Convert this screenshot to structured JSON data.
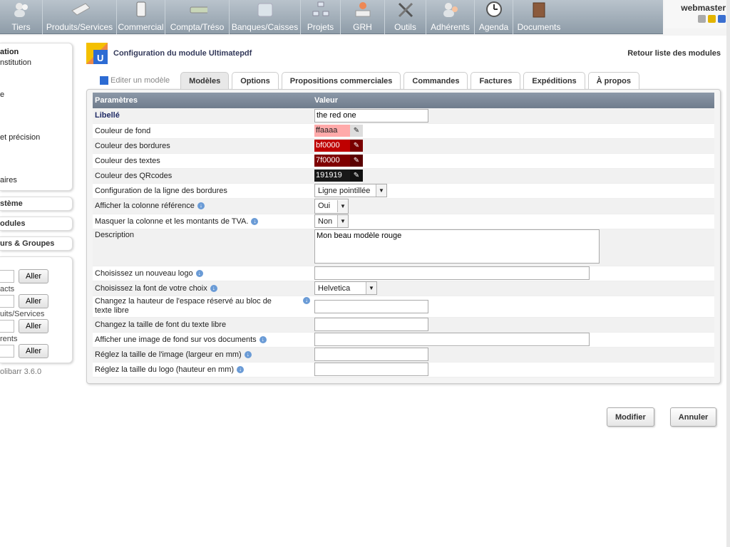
{
  "menu": [
    {
      "label": "Tiers",
      "icon": "users-icon"
    },
    {
      "label": "Produits/Services",
      "icon": "product-icon"
    },
    {
      "label": "Commercial",
      "icon": "briefcase-icon"
    },
    {
      "label": "Compta/Tréso",
      "icon": "money-icon"
    },
    {
      "label": "Banques/Caisses",
      "icon": "bank-icon"
    },
    {
      "label": "Projets",
      "icon": "project-icon"
    },
    {
      "label": "GRH",
      "icon": "hr-icon"
    },
    {
      "label": "Outils",
      "icon": "tools-icon"
    },
    {
      "label": "Adhérents",
      "icon": "members-icon"
    },
    {
      "label": "Agenda",
      "icon": "clock-icon"
    },
    {
      "label": "Documents",
      "icon": "documents-icon"
    }
  ],
  "login": {
    "user": "webmaster"
  },
  "sidebar": {
    "items": [
      "ation",
      "nstitution",
      "",
      "",
      "e",
      "",
      "",
      "",
      "et précision",
      "",
      "",
      "",
      "aires"
    ],
    "blocks": [
      "stème",
      "odules",
      "urs & Groupes"
    ],
    "search": [
      {
        "label": "",
        "button": "Aller"
      },
      {
        "label": "acts",
        "button": "Aller"
      },
      {
        "label": "uits/Services",
        "button": "Aller"
      },
      {
        "label": "rents",
        "button": "Aller"
      }
    ],
    "version": "olibarr 3.6.0"
  },
  "header": {
    "title": "Configuration du module Ultimatepdf",
    "back": "Retour liste des modules"
  },
  "tabs": [
    {
      "label": "Editer un modèle",
      "state": "plain"
    },
    {
      "label": "Modèles",
      "state": "active"
    },
    {
      "label": "Options",
      "state": ""
    },
    {
      "label": "Propositions commerciales",
      "state": ""
    },
    {
      "label": "Commandes",
      "state": ""
    },
    {
      "label": "Factures",
      "state": ""
    },
    {
      "label": "Expéditions",
      "state": ""
    },
    {
      "label": "À propos",
      "state": ""
    }
  ],
  "table": {
    "col_params": "Paramètres",
    "col_value": "Valeur",
    "libelle_label": "Libellé",
    "libelle_value": "the red one",
    "bg_label": "Couleur de fond",
    "bg_value": "ffaaaa",
    "bg_color": "#ffaaaa",
    "border_label": "Couleur des bordures",
    "border_value": "bf0000",
    "border_color": "#bf0000",
    "text_label": "Couleur des textes",
    "text_value": "7f0000",
    "text_color": "#7f0000",
    "qr_label": "Couleur des QRcodes",
    "qr_value": "191919",
    "qr_color": "#191919",
    "line_label": "Configuration de la ligne des bordures",
    "line_value": "Ligne pointillée",
    "ref_label": "Afficher la colonne référence",
    "ref_value": "Oui",
    "vat_label": "Masquer la colonne et les montants de TVA.",
    "vat_value": "Non",
    "desc_label": "Description",
    "desc_value": "Mon beau modèle rouge",
    "logo_label": "Choisissez un nouveau logo",
    "font_label": "Choisissez la font de votre choix",
    "font_value": "Helvetica",
    "height_label": "Changez la hauteur de l'espace réservé au bloc de texte libre",
    "fontsize_label": "Changez la taille de font du texte libre",
    "bgimg_label": "Afficher une image de fond sur vos documents",
    "imgwidth_label": "Réglez la taille de l'image (largeur en mm)",
    "logoheight_label": "Réglez la taille du logo (hauteur en mm)"
  },
  "buttons": {
    "save": "Modifier",
    "cancel": "Annuler"
  }
}
